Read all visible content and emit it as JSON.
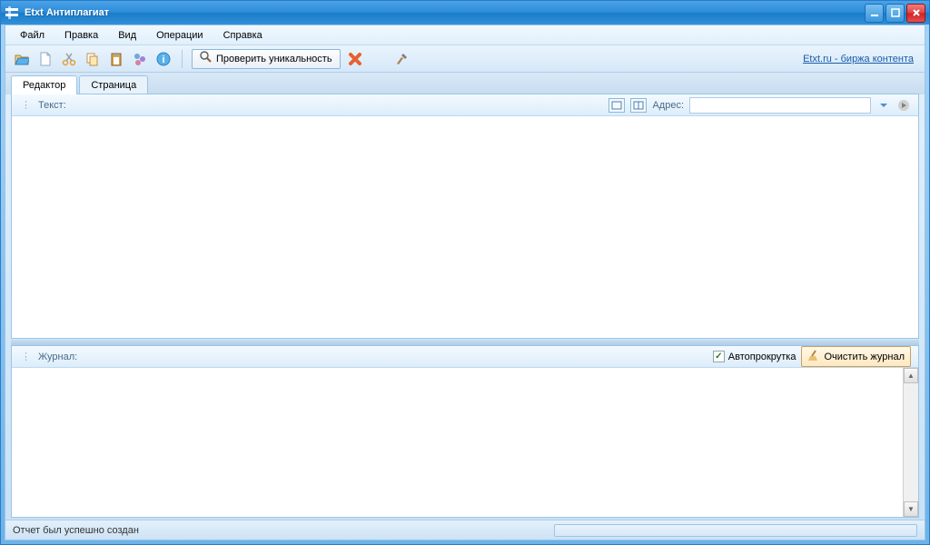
{
  "window": {
    "title": "Etxt Антиплагиат"
  },
  "menu": {
    "file": "Файл",
    "edit": "Правка",
    "view": "Вид",
    "operations": "Операции",
    "help": "Справка"
  },
  "toolbar": {
    "check_label": "Проверить уникальность",
    "link_text": "Etxt.ru - биржа контента"
  },
  "tabs": {
    "editor": "Редактор",
    "page": "Страница"
  },
  "editor_panel": {
    "text_label": "Текст:",
    "address_label": "Адрес:",
    "address_value": ""
  },
  "journal_panel": {
    "label": "Журнал:",
    "autoscroll_label": "Автопрокрутка",
    "autoscroll_checked": true,
    "clear_label": "Очистить журнал"
  },
  "statusbar": {
    "text": "Отчет был успешно создан"
  }
}
